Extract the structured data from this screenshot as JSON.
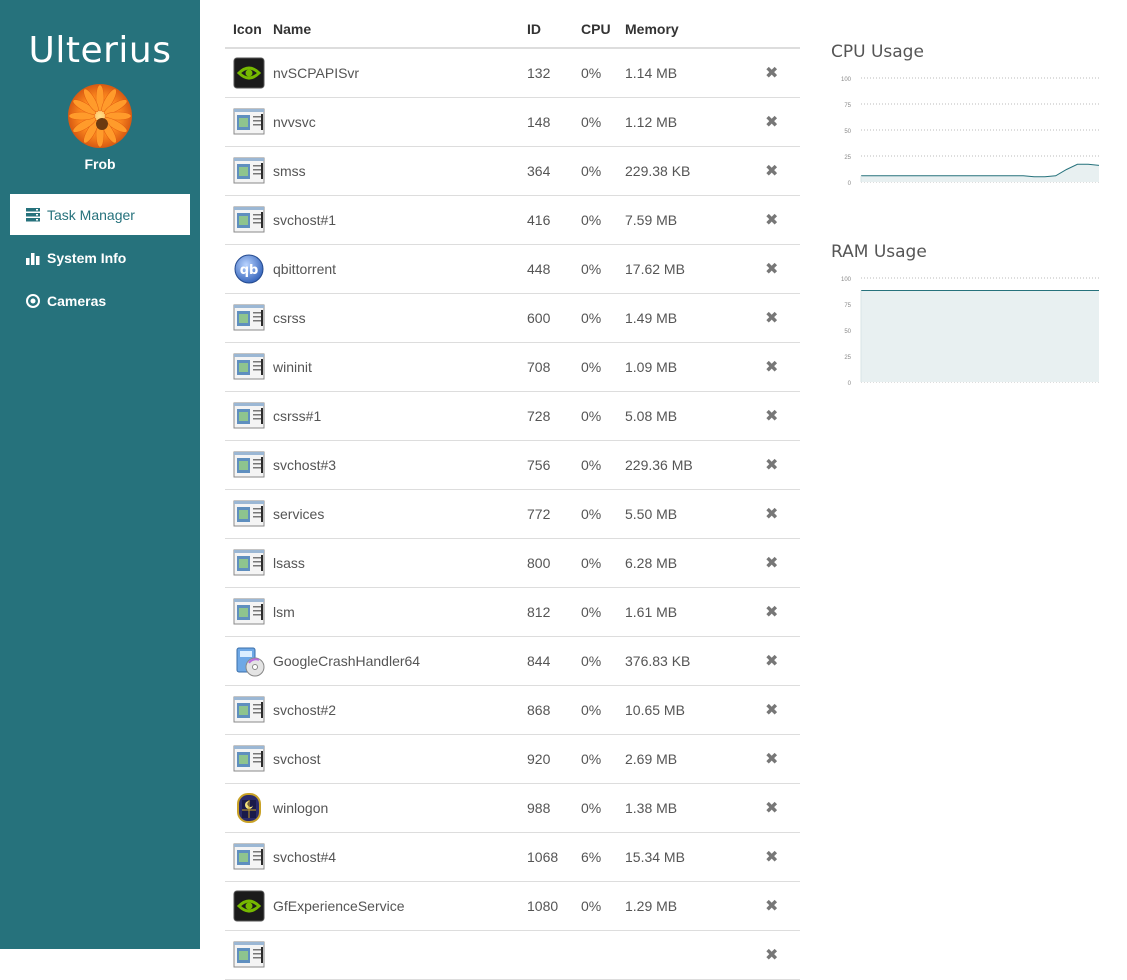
{
  "app": {
    "title": "Ulterius",
    "username": "Frob"
  },
  "nav": [
    {
      "label": "Task Manager",
      "icon": "server-icon",
      "active": true
    },
    {
      "label": "System Info",
      "icon": "bar-chart-icon",
      "active": false
    },
    {
      "label": "Cameras",
      "icon": "target-icon",
      "active": false
    }
  ],
  "table": {
    "headers": {
      "icon": "Icon",
      "name": "Name",
      "id": "ID",
      "cpu": "CPU",
      "memory": "Memory"
    },
    "rows": [
      {
        "icon": "nvidia-icon",
        "name": "nvSCPAPISvr",
        "id": "132",
        "cpu": "0%",
        "memory": "1.14 MB"
      },
      {
        "icon": "app-window-icon",
        "name": "nvvsvc",
        "id": "148",
        "cpu": "0%",
        "memory": "1.12 MB"
      },
      {
        "icon": "app-window-icon",
        "name": "smss",
        "id": "364",
        "cpu": "0%",
        "memory": "229.38 KB"
      },
      {
        "icon": "app-window-icon",
        "name": "svchost#1",
        "id": "416",
        "cpu": "0%",
        "memory": "7.59 MB"
      },
      {
        "icon": "qbittorrent-icon",
        "name": "qbittorrent",
        "id": "448",
        "cpu": "0%",
        "memory": "17.62 MB"
      },
      {
        "icon": "app-window-icon",
        "name": "csrss",
        "id": "600",
        "cpu": "0%",
        "memory": "1.49 MB"
      },
      {
        "icon": "app-window-icon",
        "name": "wininit",
        "id": "708",
        "cpu": "0%",
        "memory": "1.09 MB"
      },
      {
        "icon": "app-window-icon",
        "name": "csrss#1",
        "id": "728",
        "cpu": "0%",
        "memory": "5.08 MB"
      },
      {
        "icon": "app-window-icon",
        "name": "svchost#3",
        "id": "756",
        "cpu": "0%",
        "memory": "229.36 MB"
      },
      {
        "icon": "app-window-icon",
        "name": "services",
        "id": "772",
        "cpu": "0%",
        "memory": "5.50 MB"
      },
      {
        "icon": "app-window-icon",
        "name": "lsass",
        "id": "800",
        "cpu": "0%",
        "memory": "6.28 MB"
      },
      {
        "icon": "app-window-icon",
        "name": "lsm",
        "id": "812",
        "cpu": "0%",
        "memory": "1.61 MB"
      },
      {
        "icon": "installer-disc-icon",
        "name": "GoogleCrashHandler64",
        "id": "844",
        "cpu": "0%",
        "memory": "376.83 KB"
      },
      {
        "icon": "app-window-icon",
        "name": "svchost#2",
        "id": "868",
        "cpu": "0%",
        "memory": "10.65 MB"
      },
      {
        "icon": "app-window-icon",
        "name": "svchost",
        "id": "920",
        "cpu": "0%",
        "memory": "2.69 MB"
      },
      {
        "icon": "winlogon-icon",
        "name": "winlogon",
        "id": "988",
        "cpu": "0%",
        "memory": "1.38 MB"
      },
      {
        "icon": "app-window-icon",
        "name": "svchost#4",
        "id": "1068",
        "cpu": "6%",
        "memory": "15.34 MB"
      },
      {
        "icon": "nvidia-icon",
        "name": "GfExperienceService",
        "id": "1080",
        "cpu": "0%",
        "memory": "1.29 MB"
      },
      {
        "icon": "app-window-icon",
        "name": "",
        "id": "",
        "cpu": "",
        "memory": ""
      }
    ],
    "kill_glyph": "✖"
  },
  "colors": {
    "sidebar": "#26727c",
    "chart_line": "#26727c",
    "chart_fill": "#e8f0f1"
  },
  "chart_data": [
    {
      "type": "area",
      "title": "CPU Usage",
      "ylim": [
        0,
        100
      ],
      "yticks": [
        "100",
        "75",
        "50",
        "25",
        "0"
      ],
      "values": [
        6,
        6,
        6,
        6,
        6,
        6,
        6,
        6,
        6,
        6,
        6,
        6,
        6,
        6,
        6,
        6,
        5,
        5,
        6,
        12,
        17,
        17,
        16
      ],
      "grid": true
    },
    {
      "type": "area",
      "title": "RAM Usage",
      "ylim": [
        0,
        100
      ],
      "yticks": [
        "100",
        "75",
        "50",
        "25",
        "0"
      ],
      "values": [
        88,
        88,
        88,
        88,
        88,
        88,
        88,
        88,
        88,
        88,
        88,
        88,
        88,
        88,
        88,
        88,
        88,
        88,
        88,
        88,
        88,
        88,
        88
      ],
      "grid": true
    }
  ]
}
